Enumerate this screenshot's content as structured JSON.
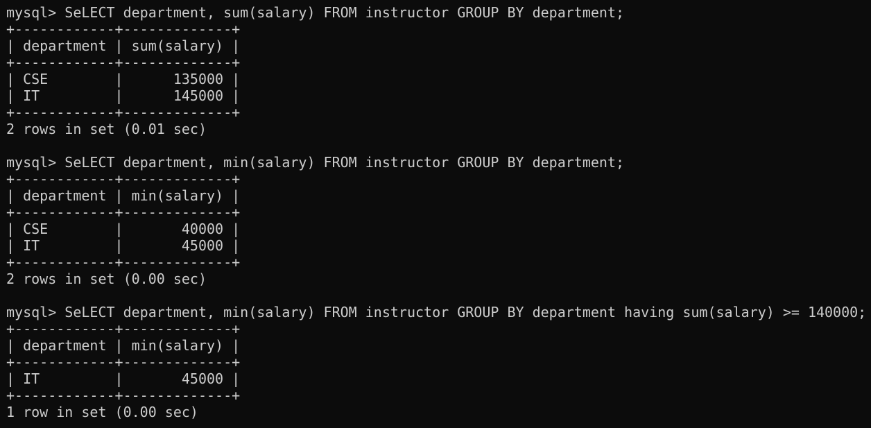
{
  "terminal": {
    "lines": [
      "mysql> SeLECT department, sum(salary) FROM instructor GROUP BY department;",
      "+------------+-------------+",
      "| department | sum(salary) |",
      "+------------+-------------+",
      "| CSE        |      135000 |",
      "| IT         |      145000 |",
      "+------------+-------------+",
      "2 rows in set (0.01 sec)",
      "",
      "mysql> SeLECT department, min(salary) FROM instructor GROUP BY department;",
      "+------------+-------------+",
      "| department | min(salary) |",
      "+------------+-------------+",
      "| CSE        |       40000 |",
      "| IT         |       45000 |",
      "+------------+-------------+",
      "2 rows in set (0.00 sec)",
      "",
      "mysql> SeLECT department, min(salary) FROM instructor GROUP BY department having sum(salary) >= 140000;",
      "+------------+-------------+",
      "| department | min(salary) |",
      "+------------+-------------+",
      "| IT         |       45000 |",
      "+------------+-------------+",
      "1 row in set (0.00 sec)"
    ]
  }
}
